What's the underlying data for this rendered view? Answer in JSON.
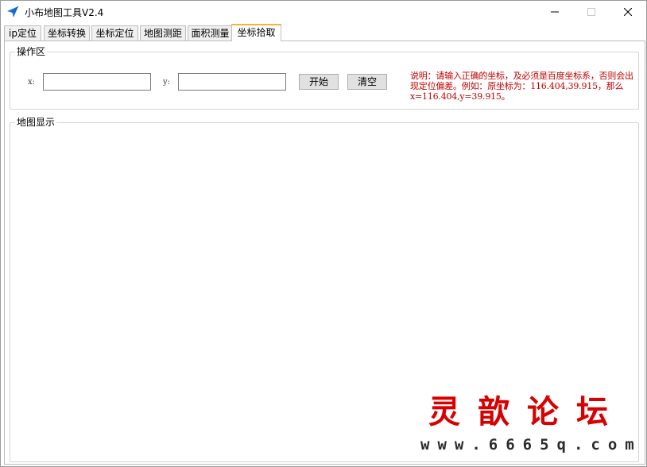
{
  "window": {
    "title": "小布地图工具V2.4",
    "controls": {
      "minimize": "minimize-icon",
      "maximize": "maximize-icon",
      "close": "close-icon"
    }
  },
  "tabs": [
    {
      "label": "ip定位",
      "active": false
    },
    {
      "label": "坐标转换",
      "active": false
    },
    {
      "label": "坐标定位",
      "active": false
    },
    {
      "label": "地图测距",
      "active": false
    },
    {
      "label": "面积测量",
      "active": false
    },
    {
      "label": "坐标拾取",
      "active": true
    }
  ],
  "operation": {
    "group_title": "操作区",
    "x_label": "x:",
    "y_label": "y:",
    "x_value": "",
    "y_value": "",
    "start_button": "开始",
    "clear_button": "清空",
    "note": "说明：请输入正确的坐标，及必须是百度坐标系，否则会出现定位偏差。例如：原坐标为：116.404,39.915，那么x=116.404,y=39.915。"
  },
  "map": {
    "group_title": "地图显示"
  },
  "watermark": {
    "title": "灵歆论坛",
    "url": "www.6665q.com"
  },
  "colors": {
    "note_text": "#c20000",
    "active_tab_accent": "#f3b43d",
    "app_icon": "#1a73d9",
    "watermark_title": "#d80000"
  }
}
